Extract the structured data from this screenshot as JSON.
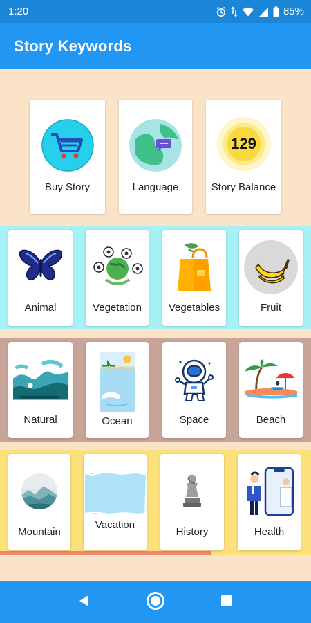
{
  "status_bar": {
    "time": "1:20",
    "battery": "85%",
    "icons": [
      "alarm-icon",
      "data-icon",
      "wifi-icon",
      "signal-icon",
      "battery-icon"
    ]
  },
  "app_bar": {
    "title": "Story Keywords"
  },
  "top_cards": [
    {
      "label": "Buy Story",
      "icon": "cart-icon"
    },
    {
      "label": "Language",
      "icon": "globe-icon"
    },
    {
      "label": "Story Balance",
      "value": "129",
      "icon": "coin-icon"
    }
  ],
  "row1": [
    {
      "label": "Animal",
      "icon": "butterfly-icon"
    },
    {
      "label": "Vegetation",
      "icon": "earth-flowers-icon"
    },
    {
      "label": "Vegetables",
      "icon": "shopping-bag-icon"
    },
    {
      "label": "Fruit",
      "icon": "banana-icon"
    }
  ],
  "row2": [
    {
      "label": "Natural",
      "icon": "landscape-icon"
    },
    {
      "label": "Ocean",
      "icon": "ocean-icon"
    },
    {
      "label": "Space",
      "icon": "astronaut-icon"
    },
    {
      "label": "Beach",
      "icon": "beach-icon"
    }
  ],
  "row3": [
    {
      "label": "Mountain",
      "icon": "mountain-icon"
    },
    {
      "label": "Vacation",
      "icon": "vacation-icon"
    },
    {
      "label": "History",
      "icon": "chess-icon"
    },
    {
      "label": "Health",
      "icon": "doctor-icon"
    }
  ],
  "nav_bar": {
    "buttons": [
      "back-icon",
      "home-icon",
      "recents-icon"
    ]
  },
  "colors": {
    "status_bar": "#1b86d8",
    "app_bar": "#2196f3",
    "background": "#fbe3c8",
    "band_cyan": "#a6f1f5",
    "band_brown": "#c8a598",
    "band_yellow": "#fce07a"
  }
}
